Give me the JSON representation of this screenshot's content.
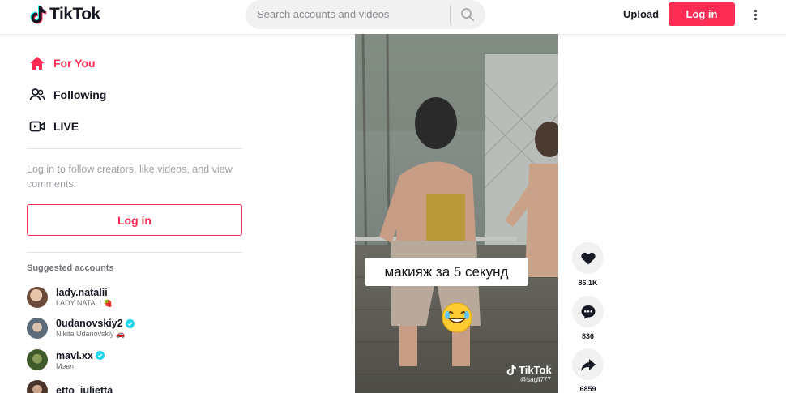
{
  "header": {
    "logo_text": "TikTok",
    "search_placeholder": "Search accounts and videos",
    "upload_label": "Upload",
    "login_label": "Log in"
  },
  "sidebar": {
    "nav": [
      {
        "label": "For You",
        "icon": "home-icon"
      },
      {
        "label": "Following",
        "icon": "users-icon"
      },
      {
        "label": "LIVE",
        "icon": "live-icon"
      }
    ],
    "login_hint": "Log in to follow creators, like videos, and view comments.",
    "login_label": "Log in",
    "suggested_title": "Suggested accounts",
    "accounts": [
      {
        "username": "lady.natalii",
        "nickname": "LADY NATALI 🍓",
        "verified": false
      },
      {
        "username": "0udanovskiy2",
        "nickname": "Nikita Udanovskiy 🚗",
        "verified": true
      },
      {
        "username": "mavl.xx",
        "nickname": "Мэвл",
        "verified": true
      },
      {
        "username": "etto_julietta",
        "nickname": "",
        "verified": false
      }
    ]
  },
  "video": {
    "caption": "макияж за 5 секунд",
    "watermark_logo": "TikTok",
    "watermark_user": "@sagli777"
  },
  "actions": {
    "likes": "86.1K",
    "comments": "836",
    "shares": "6859"
  },
  "colors": {
    "accent": "#fe2c55",
    "verified": "#20d5ec"
  }
}
